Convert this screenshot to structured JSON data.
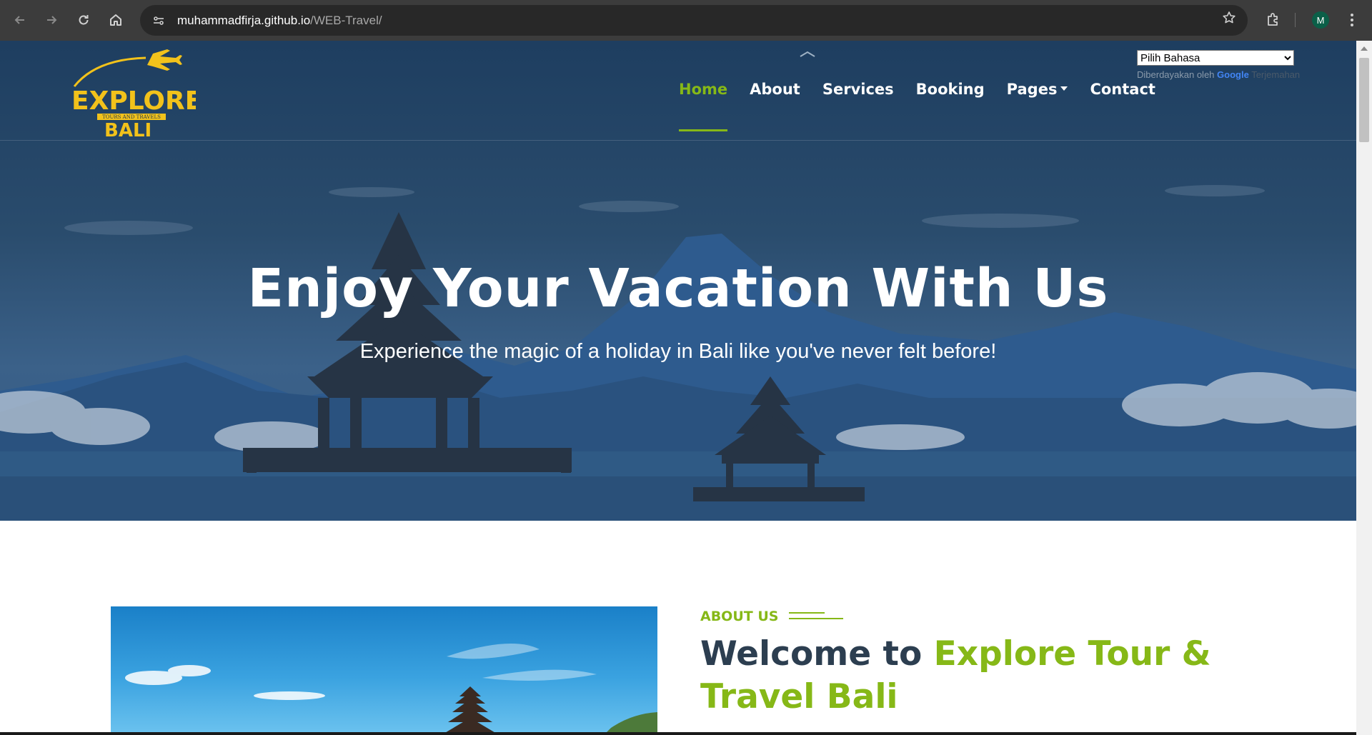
{
  "browser": {
    "url_host": "muhammadfirja.github.io",
    "url_path": "/WEB-Travel/",
    "profile_initial": "M",
    "icons": [
      "back-icon",
      "forward-icon",
      "reload-icon",
      "home-icon",
      "site-info-icon",
      "bookmark-star-icon",
      "extensions-icon",
      "more-menu-icon"
    ]
  },
  "navbar": {
    "logo_text": "EXPLORE",
    "logo_tagline": "TOURS AND TRAVELS",
    "logo_bottom": "BALI",
    "items": [
      {
        "label": "Home",
        "active": true
      },
      {
        "label": "About",
        "active": false
      },
      {
        "label": "Services",
        "active": false
      },
      {
        "label": "Booking",
        "active": false
      },
      {
        "label": "Pages",
        "active": false,
        "dropdown": true
      },
      {
        "label": "Contact",
        "active": false
      }
    ]
  },
  "translate": {
    "select_value": "Pilih Bahasa",
    "powered_by": "Diberdayakan oleh",
    "google": "Google",
    "translate_label": "Terjemahan"
  },
  "hero": {
    "title": "Enjoy Your Vacation With Us",
    "subtitle": "Experience the magic of a holiday in Bali like you've never felt before!"
  },
  "about": {
    "label": "ABOUT US",
    "title_prefix": "Welcome to ",
    "title_highlight": "Explore Tour & Travel Bali"
  },
  "colors": {
    "accent": "#86b817",
    "heading": "#2c3e50",
    "logo_yellow": "#f2c21b"
  }
}
